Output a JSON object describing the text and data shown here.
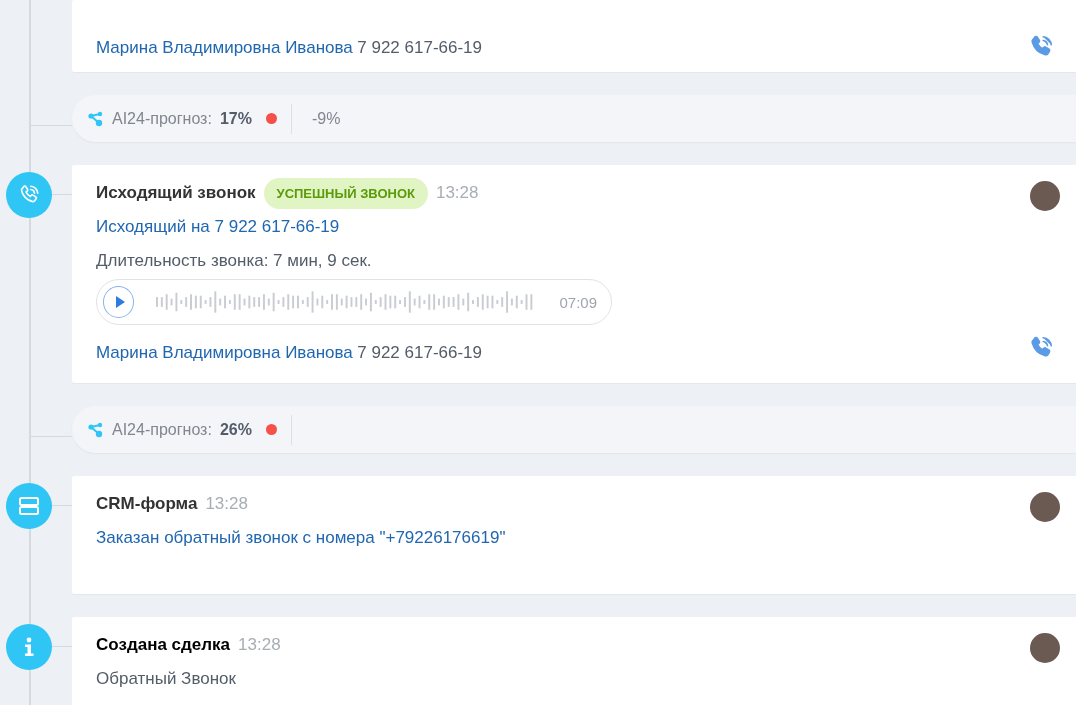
{
  "timeline": [
    {
      "kind": "contact",
      "contact_name": "Марина Владимировна Иванова",
      "contact_phone": "7 922 617-66-19"
    },
    {
      "kind": "forecast",
      "label": "AI24-прогноз:",
      "value": "17%",
      "color": "#f5504a",
      "delta": "-9%"
    },
    {
      "kind": "call",
      "title": "Исходящий звонок",
      "badge": "УСПЕШНЫЙ ЗВОНОК",
      "time": "13:28",
      "link": "Исходящий на 7 922 617-66-19",
      "duration": "Длительность звонка: 7 мин, 9 сек.",
      "record_time": "07:09",
      "contact_name": "Марина Владимировна Иванова",
      "contact_phone": "7 922 617-66-19"
    },
    {
      "kind": "forecast",
      "label": "AI24-прогноз:",
      "value": "26%",
      "color": "#f5504a"
    },
    {
      "kind": "form",
      "title": "CRM-форма",
      "time": "13:28",
      "link": "Заказан обратный звонок с номера \"+79226176619\""
    },
    {
      "kind": "deal",
      "title": "Создана сделка",
      "time": "13:28",
      "text": "Обратный Звонок"
    }
  ]
}
